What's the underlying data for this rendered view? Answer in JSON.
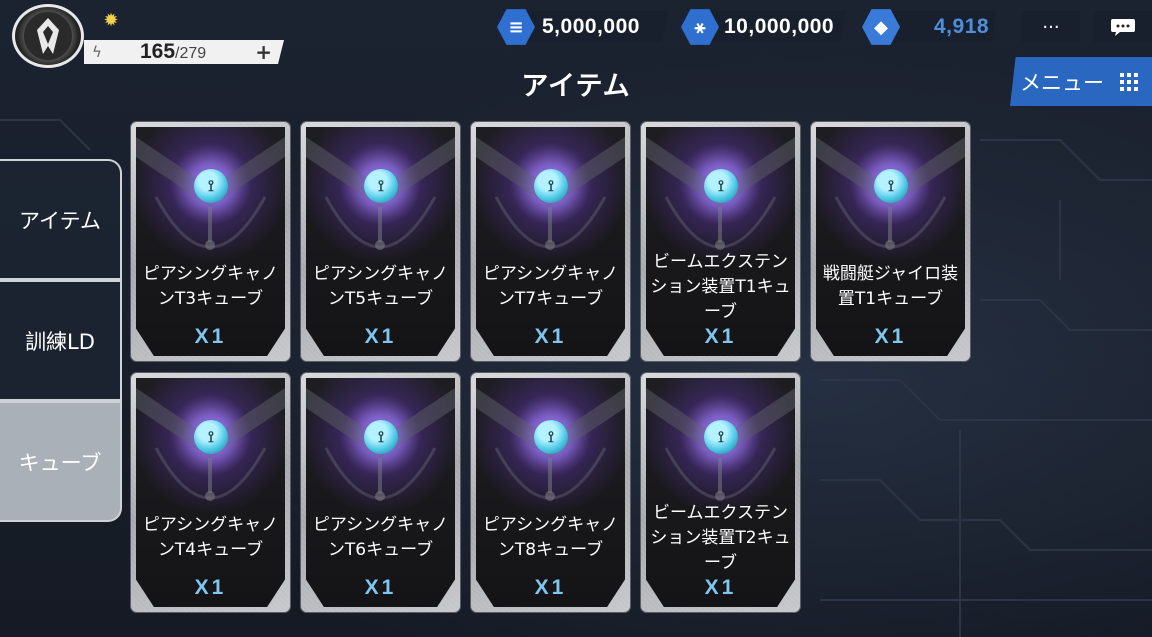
{
  "header": {
    "energy": {
      "current": "165",
      "separator": "/",
      "max": "279",
      "plus_label": "+"
    },
    "currencies": [
      {
        "icon": "stack-icon",
        "value": "5,000,000"
      },
      {
        "icon": "molecule-icon",
        "value": "10,000,000"
      },
      {
        "icon": "crystal-icon",
        "value": "4,918"
      }
    ],
    "more_label": "···",
    "page_title": "アイテム",
    "menu_label": "メニュー"
  },
  "tabs": [
    {
      "label": "アイテム",
      "selected": false
    },
    {
      "label": "訓練LD",
      "selected": false
    },
    {
      "label": "キューブ",
      "selected": true
    }
  ],
  "items": [
    {
      "name": "ピアシングキャノンT3キューブ",
      "qty": "X1"
    },
    {
      "name": "ピアシングキャノンT5キューブ",
      "qty": "X1"
    },
    {
      "name": "ピアシングキャノンT7キューブ",
      "qty": "X1"
    },
    {
      "name": "ビームエクステンション装置T1キューブ",
      "qty": "X1"
    },
    {
      "name": "戦闘艇ジャイロ装置T1キューブ",
      "qty": "X1"
    },
    {
      "name": "ピアシングキャノンT4キューブ",
      "qty": "X1"
    },
    {
      "name": "ピアシングキャノンT6キューブ",
      "qty": "X1"
    },
    {
      "name": "ピアシングキャノンT8キューブ",
      "qty": "X1"
    },
    {
      "name": "ビームエクステンション装置T2キューブ",
      "qty": "X1"
    }
  ],
  "colors": {
    "accent_blue": "#2a67c0",
    "qty_color": "#7fc6f0",
    "crystal_value": "#4f8fd9"
  }
}
